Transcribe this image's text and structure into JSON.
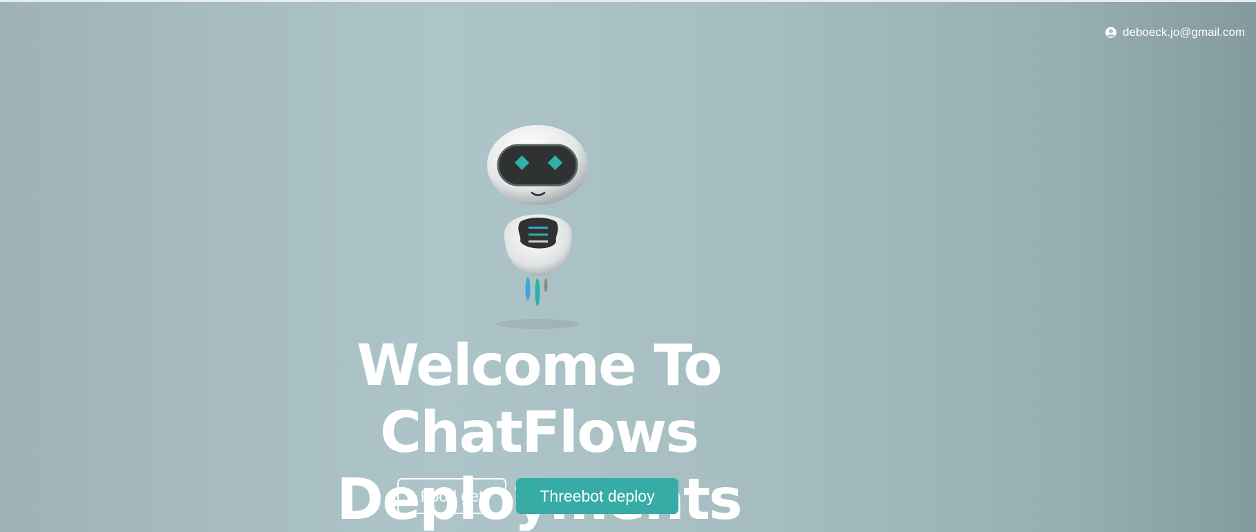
{
  "header": {
    "user_icon": "user-circle-icon",
    "user_email": "deboeck.jo@gmail.com"
  },
  "hero": {
    "illustration": "robot-mascot",
    "title": "Welcome To ChatFlows Deployments"
  },
  "actions": {
    "secondary_label": "Food get",
    "primary_label": "Threebot deploy"
  },
  "colors": {
    "primary": "#37aba5",
    "background": "#a6bec1",
    "text": "#ffffff"
  }
}
